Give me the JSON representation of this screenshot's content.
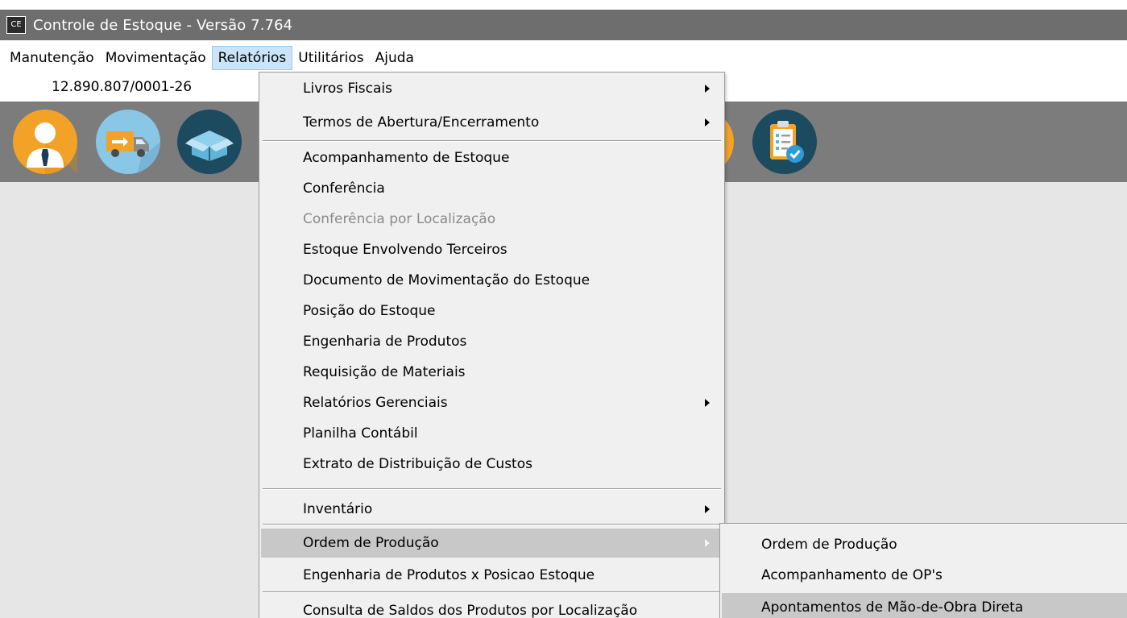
{
  "window": {
    "title": "Controle de Estoque - Versão 7.764",
    "app_icon_text": "CE"
  },
  "menubar": {
    "items": [
      {
        "label": "Manutenção"
      },
      {
        "label": "Movimentação"
      },
      {
        "label": "Relatórios"
      },
      {
        "label": "Utilitários"
      },
      {
        "label": "Ajuda"
      }
    ],
    "active": "Relatórios"
  },
  "company": {
    "cnpj": "12.890.807/0001-26"
  },
  "toolbar": {
    "icons": [
      "user-icon",
      "delivery-truck-icon",
      "box-icon",
      "clipboard-check-icon"
    ],
    "colors": {
      "background": "#7c7c7c",
      "orange": "#f2a227",
      "light_blue": "#8ac6e6",
      "dark_teal": "#1c4a5e"
    }
  },
  "relatorios_menu": {
    "items": [
      {
        "label": "Livros Fiscais"
      },
      {
        "label": "Termos de Abertura/Encerramento"
      },
      {
        "label": "Acompanhamento de Estoque"
      },
      {
        "label": "Conferência"
      },
      {
        "label": "Conferência por Localização"
      },
      {
        "label": "Estoque Envolvendo Terceiros"
      },
      {
        "label": "Documento de Movimentação do Estoque"
      },
      {
        "label": "Posição do Estoque"
      },
      {
        "label": "Engenharia de Produtos"
      },
      {
        "label": "Requisição de Materiais"
      },
      {
        "label": "Relatórios Gerenciais"
      },
      {
        "label": "Planilha Contábil"
      },
      {
        "label": "Extrato de Distribuição de Custos"
      },
      {
        "label": "Inventário"
      },
      {
        "label": "Ordem de Produção"
      },
      {
        "label": "Engenharia de Produtos x Posicao Estoque"
      },
      {
        "label": "Consulta de Saldos dos Produtos por Localização"
      }
    ],
    "disabled": [
      "Conferência por Localização"
    ],
    "with_submenu": [
      "Livros Fiscais",
      "Termos de Abertura/Encerramento",
      "Relatórios Gerenciais",
      "Inventário",
      "Ordem de Produção"
    ],
    "highlighted": "Ordem de Produção"
  },
  "ordem_producao_submenu": {
    "items": [
      {
        "label": "Ordem de Produção"
      },
      {
        "label": "Acompanhamento de OP's"
      },
      {
        "label": "Apontamentos de Mão-de-Obra Direta"
      }
    ],
    "highlighted": "Apontamentos de Mão-de-Obra Direta"
  }
}
